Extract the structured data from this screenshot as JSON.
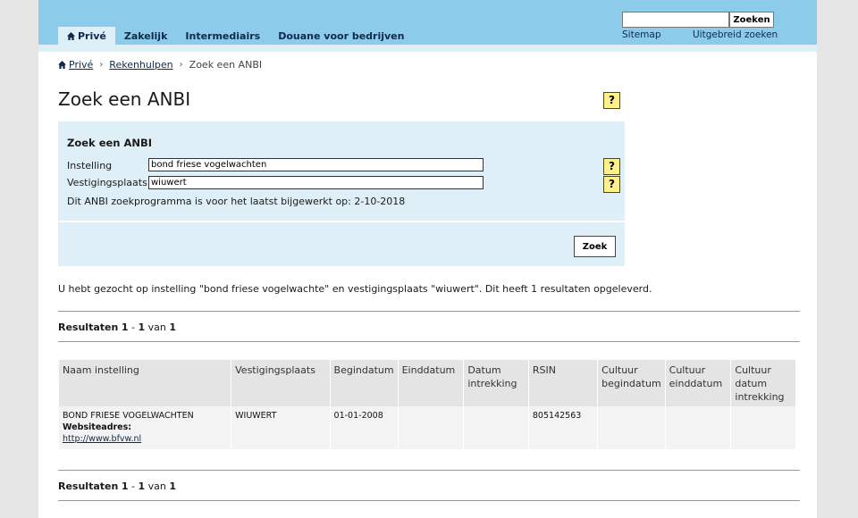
{
  "nav": {
    "tabs": [
      {
        "label": "Privé",
        "active": true
      },
      {
        "label": "Zakelijk",
        "active": false
      },
      {
        "label": "Intermediairs",
        "active": false
      },
      {
        "label": "Douane voor bedrijven",
        "active": false
      }
    ],
    "search": {
      "value": "",
      "button_label": "Zoeken"
    },
    "links": {
      "sitemap": "Sitemap",
      "advanced": "Uitgebreid zoeken"
    }
  },
  "breadcrumb": {
    "items": [
      "Privé",
      "Rekenhulpen"
    ],
    "current": "Zoek een ANBI"
  },
  "page": {
    "title": "Zoek een ANBI",
    "help_label": "?"
  },
  "form": {
    "heading": "Zoek een ANBI",
    "instelling_label": "Instelling",
    "instelling_value": "bond friese vogelwachten",
    "vestigingsplaats_label": "Vestigingsplaats",
    "vestigingsplaats_value": "wiuwert",
    "note": "Dit ANBI zoekprogramma is voor het laatst bijgewerkt op: 2-10-2018",
    "submit_label": "Zoek"
  },
  "summary": "U hebt gezocht op instelling \"bond friese vogelwachte\" en vestigingsplaats \"wiuwert\". Dit heeft 1 resultaten opgeleverd.",
  "results_count": {
    "prefix": "Resultaten",
    "from": "1",
    "dash": "-",
    "to": "1",
    "of_word": "van",
    "total": "1"
  },
  "table": {
    "headers": [
      "Naam instelling",
      "Vestigingsplaats",
      "Begindatum",
      "Einddatum",
      "Datum intrekking",
      "RSIN",
      "Cultuur begindatum",
      "Cultuur einddatum",
      "Cultuur datum intrekking"
    ],
    "rows": [
      {
        "naam": "BOND FRIESE VOGELWACHTEN",
        "website_label": "Websiteadres:",
        "website": "http://www.bfvw.nl",
        "vestigingsplaats": "WIUWERT",
        "begindatum": "01-01-2008",
        "einddatum": "",
        "datum_intrekking": "",
        "rsin": "805142563",
        "cultuur_begindatum": "",
        "cultuur_einddatum": "",
        "cultuur_datum_intrekking": ""
      }
    ]
  },
  "colors": {
    "topbar": "#8ccbea",
    "formbox": "#deeff8",
    "help": "#fff08a"
  }
}
